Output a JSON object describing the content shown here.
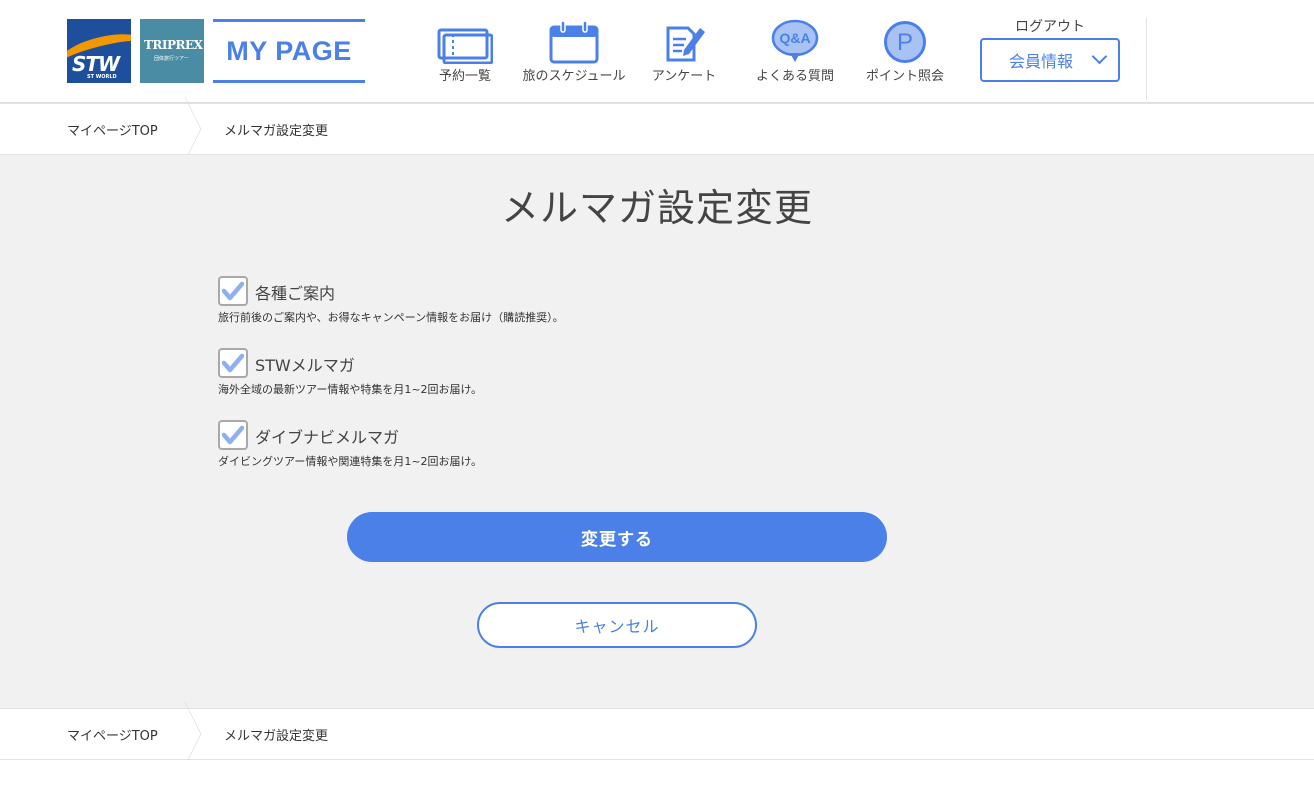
{
  "header": {
    "logos": {
      "stw_text": "STW",
      "stw_sub": "ST WORLD",
      "triprex_text": "TRIPREX",
      "triprex_sub": "団体旅行ツアー"
    },
    "mypage_label": "MY PAGE",
    "nav": [
      {
        "label": "予約一覧",
        "icon": "ticket-icon"
      },
      {
        "label": "旅のスケジュール",
        "icon": "calendar-icon"
      },
      {
        "label": "アンケート",
        "icon": "survey-pencil-icon"
      },
      {
        "label": "よくある質問",
        "icon": "qa-bubble-icon"
      },
      {
        "label": "ポイント照会",
        "icon": "point-coin-icon"
      }
    ],
    "logout_label": "ログアウト",
    "member_label": "会員情報"
  },
  "breadcrumb": {
    "home": "マイページTOP",
    "current": "メルマガ設定変更"
  },
  "main": {
    "title": "メルマガ設定変更",
    "options": [
      {
        "label": "各種ご案内",
        "description": "旅行前後のご案内や、お得なキャンペーン情報をお届け（購読推奨）。",
        "checked": true
      },
      {
        "label": "STWメルマガ",
        "description": "海外全域の最新ツアー情報や特集を月1~2回お届け。",
        "checked": true
      },
      {
        "label": "ダイブナビメルマガ",
        "description": "ダイビングツアー情報や関連特集を月1~2回お届け。",
        "checked": true
      }
    ],
    "submit_label": "変更する",
    "cancel_label": "キャンセル"
  },
  "colors": {
    "accent": "#4a80e8",
    "background": "#f1f1f1",
    "stw_blue": "#1e4f9c",
    "stw_orange": "#f39800",
    "triprex_teal": "#4a8ca3"
  }
}
